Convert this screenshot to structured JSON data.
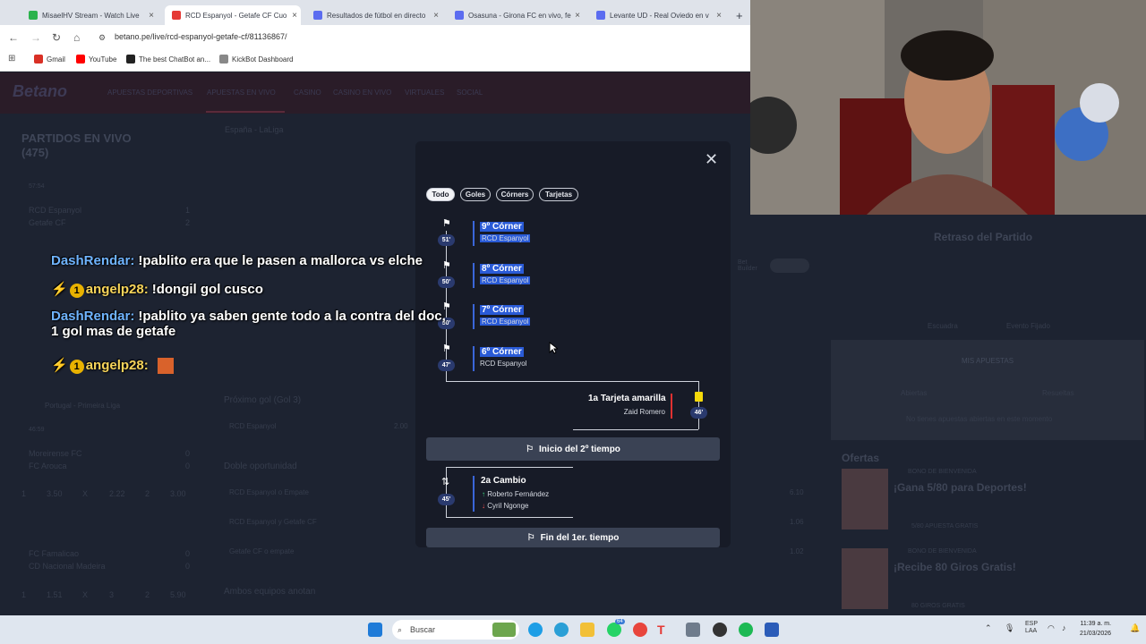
{
  "browser": {
    "tabs": [
      {
        "label": "MisaelHV Stream - Watch Live",
        "color": "#2bb24c",
        "active": false
      },
      {
        "label": "RCD Espanyol - Getafe CF Cuo",
        "color": "#e53935",
        "active": true
      },
      {
        "label": "Resultados de fútbol en directo",
        "color": "#5b6cf0",
        "active": false
      },
      {
        "label": "Osasuna - Girona FC en vivo, fe",
        "color": "#5b6cf0",
        "active": false
      },
      {
        "label": "Levante UD - Real Oviedo en v",
        "color": "#5b6cf0",
        "active": false
      }
    ],
    "url": "betano.pe/live/rcd-espanyol-getafe-cf/81136867/",
    "bookmarks": [
      {
        "label": "Gmail",
        "color": "#d93025"
      },
      {
        "label": "YouTube",
        "color": "#ff0000"
      },
      {
        "label": "The best ChatBot an...",
        "color": "#222"
      },
      {
        "label": "KickBot Dashboard",
        "color": "#888"
      }
    ]
  },
  "site": {
    "logo": "Betano",
    "nav": [
      "APUESTAS DEPORTIVAS",
      "APUESTAS EN VIVO",
      "CASINO",
      "CASINO EN VIVO",
      "VIRTUALES",
      "SOCIAL"
    ],
    "sidebar_title": "PARTIDOS EN VIVO (475)",
    "breadcrumb": "España - LaLiga",
    "matches": [
      {
        "home": "RCD Espanyol",
        "away": "Getafe CF",
        "hs": "1",
        "as": "2",
        "time": "57:54"
      },
      {
        "home": "Moreirense FC",
        "away": "FC Arouca",
        "hs": "0",
        "as": "0",
        "time": "46:59"
      },
      {
        "home": "FC Famalicao",
        "away": "CD Nacional Madeira",
        "hs": "0",
        "as": "0",
        "time": ""
      }
    ],
    "league2": "Portugal - Primeira Liga",
    "odds_row": [
      "1",
      "3.50",
      "X",
      "2.22",
      "2",
      "3.00"
    ],
    "odds_row2": [
      "1",
      "1.51",
      "X",
      "3",
      "2",
      "5.90"
    ],
    "markets": [
      "Próximo gol (Gol 3)",
      "Doble oportunidad",
      "Ambos equipos anotan"
    ],
    "market_rows": [
      {
        "label": "RCD Espanyol",
        "val": "2.00"
      },
      {
        "label": "RCD Espanyol o Empate",
        "val": "6.10"
      },
      {
        "label": "RCD Espanyol y Getafe CF",
        "val": "1.06"
      },
      {
        "label": "Getafe CF o empate",
        "val": "1.02"
      }
    ],
    "right": {
      "delay": "Retraso del Partido",
      "bet_builder": "Bet Builder",
      "escuadra": "Escuadra",
      "eventos": "Evento Fijado",
      "mis_apuestas": "MIS APUESTAS",
      "abiertas": "Abiertas",
      "resueltas": "Resueltas",
      "empty": "No tienes apuestas abiertas en este momento",
      "ofertas": "Ofertas",
      "offers": [
        {
          "tag": "BONO DE BIENVENIDA",
          "title": "¡Gana 5/80 para Deportes!",
          "sub": "5/80 APUESTA GRATIS"
        },
        {
          "tag": "BONO DE BIENVENIDA",
          "title": "¡Recibe 80 Giros Gratis!",
          "sub": "80 GIROS GRATIS"
        }
      ]
    }
  },
  "modal": {
    "filters": [
      "Todo",
      "Goles",
      "Córners",
      "Tarjetas"
    ],
    "events": [
      {
        "minute": "51'",
        "title": "9º Córner",
        "team": "RCD Espanyol",
        "highlight": true
      },
      {
        "minute": "50'",
        "title": "8º Córner",
        "team": "RCD Espanyol",
        "highlight": true
      },
      {
        "minute": "50'",
        "title": "7º Córner",
        "team": "RCD Espanyol",
        "highlight": true
      },
      {
        "minute": "47'",
        "title": "6º Córner",
        "team": "RCD Espanyol",
        "highlight": false
      }
    ],
    "card": {
      "minute": "46'",
      "title": "1a Tarjeta amarilla",
      "player": "Zaid Romero",
      "color": "#f5d90a"
    },
    "second_half": "Inicio del 2º tiempo",
    "sub": {
      "minute": "45'",
      "title": "2a Cambio",
      "in": "Roberto Fernández",
      "out": "Cyril Ngonge"
    },
    "first_half_end": "Fin del 1er. tiempo"
  },
  "chat": [
    {
      "user": "DashRendar:",
      "text": "!pablito era que le pasen a mallorca vs elche",
      "badge": false
    },
    {
      "user": "angelp28:",
      "text": "!dongil gol cusco",
      "badge": true
    },
    {
      "user": "DashRendar:",
      "text": "!pablito ya saben gente todo a la contra del doc,",
      "text2": "1 gol mas de getafe",
      "badge": false
    },
    {
      "user": "angelp28:",
      "text": "",
      "badge": true
    }
  ],
  "taskbar": {
    "search": "Buscar",
    "time": "11:39 a. m.",
    "date": "21/03/2026",
    "lang": "ESP",
    "lang2": "LAA",
    "notif_count": "64"
  }
}
